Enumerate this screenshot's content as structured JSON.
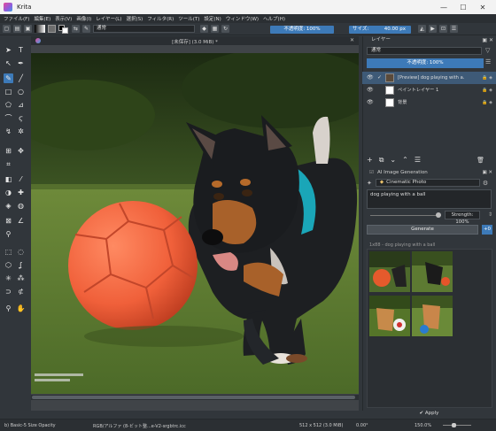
{
  "window": {
    "title": "Krita",
    "controls": [
      "—",
      "☐",
      "✕"
    ]
  },
  "menu": [
    "ファイル(F)",
    "編集(E)",
    "表示(V)",
    "画像(I)",
    "レイヤー(L)",
    "選択(S)",
    "フィルタ(R)",
    "ツール(T)",
    "設定(N)",
    "ウィンドウ(W)",
    "ヘルプ(H)"
  ],
  "toolbar": {
    "blend_mode": "通常",
    "opacity": "不透明度: 100%",
    "size_label": "サイズ:",
    "size_value": "40.00 px"
  },
  "document": {
    "title": "[未保存] (3.0 MiB) *",
    "image_description_alt": "dog"
  },
  "layers_docker": {
    "title": "レイヤー",
    "blend_mode": "通常",
    "opacity": "不透明度: 100%",
    "layers": [
      {
        "name": "[Preview] dog playing with a...",
        "visible": true,
        "selected": true
      },
      {
        "name": "ペイントレイヤー 1",
        "visible": true,
        "selected": false
      },
      {
        "name": "背景",
        "visible": true,
        "selected": false
      }
    ]
  },
  "ai_docker": {
    "title": "AI Image Generation",
    "style": "Cinematic Photo",
    "prompt": "dog playing with a ball",
    "strength": "Strength: 100%",
    "generate_label": "Generate",
    "plus_label": "+0",
    "history_label": "1x88 - dog playing with a ball",
    "apply_label": "Apply"
  },
  "statusbar": {
    "brush": "b) Basic-5 Size Opacity",
    "color_profile": "RGB/アルファ (8-ビット整...e-V2-srgbtrc.icc",
    "dimensions": "512 x 512 (3.0 MiB)",
    "rotation": "0.00°",
    "zoom": "150.0%"
  },
  "colors": {
    "accent": "#3d7ab8",
    "panel": "#31363b",
    "selected_layer": "#3e5a77"
  }
}
